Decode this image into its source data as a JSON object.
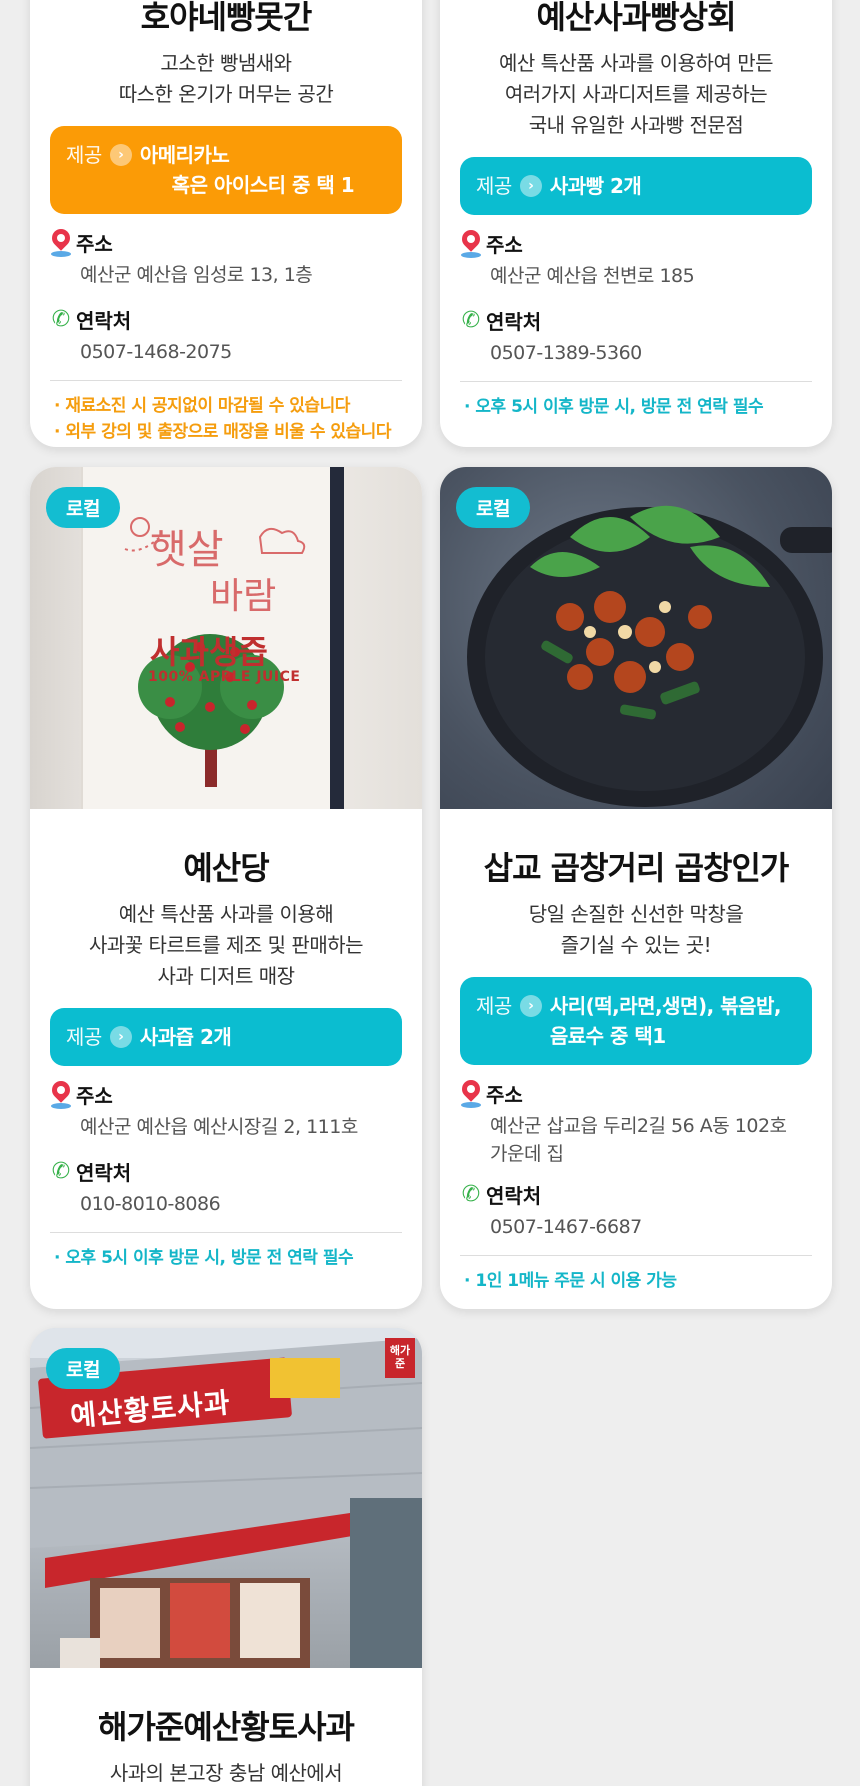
{
  "cards": [
    {
      "title": "호야네빵못간",
      "desc_lines": [
        "고소한 빵냄새와",
        "따스한 온기가 머무는 공간"
      ],
      "provide_label": "제공",
      "provide_lines": [
        "아메리카노",
        "혹은 아이스티 중 택 1"
      ],
      "address_label": "주소",
      "address": "예산군 예산읍 임성로 13, 1층",
      "contact_label": "연락처",
      "contact": "0507-1468-2075",
      "notes": [
        "· 재료소진 시 공지없이 마감될 수 있습니다",
        "· 외부 강의 및 출장으로 매장을 비울 수 있습니다"
      ]
    },
    {
      "title": "예산사과빵상회",
      "desc_lines": [
        "예산 특산품 사과를 이용하여 만든",
        "여러가지 사과디저트를 제공하는",
        "국내 유일한 사과빵 전문점"
      ],
      "provide_label": "제공",
      "provide_lines": [
        "사과빵 2개"
      ],
      "address_label": "주소",
      "address": "예산군 예산읍 천변로 185",
      "contact_label": "연락처",
      "contact": "0507-1389-5360",
      "notes": [
        "· 오후 5시 이후 방문 시, 방문 전 연락 필수"
      ]
    },
    {
      "badge": "로컬",
      "title": "예산당",
      "desc_lines": [
        "예산 특산품 사과를 이용해",
        "사과꽃 타르트를 제조 및 판매하는",
        "사과 디저트 매장"
      ],
      "provide_label": "제공",
      "provide_lines": [
        "사과즙 2개"
      ],
      "address_label": "주소",
      "address": "예산군 예산읍 예산시장길 2, 111호",
      "contact_label": "연락처",
      "contact": "010-8010-8086",
      "notes": [
        "· 오후 5시 이후 방문 시, 방문 전 연락 필수"
      ],
      "photo_text": {
        "line1": "햇살",
        "line2": "바람",
        "line3": "사과생즙",
        "line4": "100% APPLE JUICE"
      }
    },
    {
      "badge": "로컬",
      "title": "삽교 곱창거리 곱창인가",
      "desc_lines": [
        "당일 손질한 신선한 막창을",
        "즐기실 수 있는 곳!"
      ],
      "provide_label": "제공",
      "provide_lines": [
        "사리(떡,라면,생면), 볶음밥,",
        "음료수 중 택1"
      ],
      "address_label": "주소",
      "address_lines": [
        "예산군 삽교읍 두리2길 56 A동 102호",
        "가운데 집"
      ],
      "contact_label": "연락처",
      "contact": "0507-1467-6687",
      "notes": [
        "· 1인 1메뉴 주문 시 이용 가능"
      ]
    },
    {
      "badge": "로컬",
      "title": "해가준예산황토사과",
      "desc_lines": [
        "사과의 본고장 충남 예산에서"
      ],
      "photo_text": {
        "sign": "예산황토사과",
        "brand": "해가준"
      }
    }
  ],
  "colors": {
    "teal": "#0bbdd0",
    "orange": "#fb9b06",
    "pin": "#e8344a",
    "phone": "#36b14a"
  }
}
